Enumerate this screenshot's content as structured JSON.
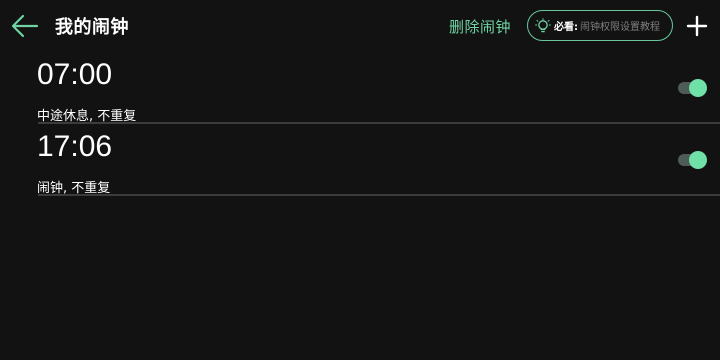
{
  "header": {
    "title": "我的闹钟",
    "delete_label": "删除闹钟",
    "tip_prefix": "必看:",
    "tip_text": "闹钟权限设置教程",
    "icons": {
      "back": "arrow-left-icon",
      "bulb": "lightbulb-icon",
      "add": "plus-icon"
    }
  },
  "alarms": [
    {
      "time": "07:00",
      "label": "中途休息, 不重复",
      "enabled": true
    },
    {
      "time": "17:06",
      "label": "闹钟, 不重复",
      "enabled": true
    }
  ],
  "colors": {
    "accent": "#6fd3a3",
    "knob": "#6fe0a8",
    "background": "#121212"
  }
}
